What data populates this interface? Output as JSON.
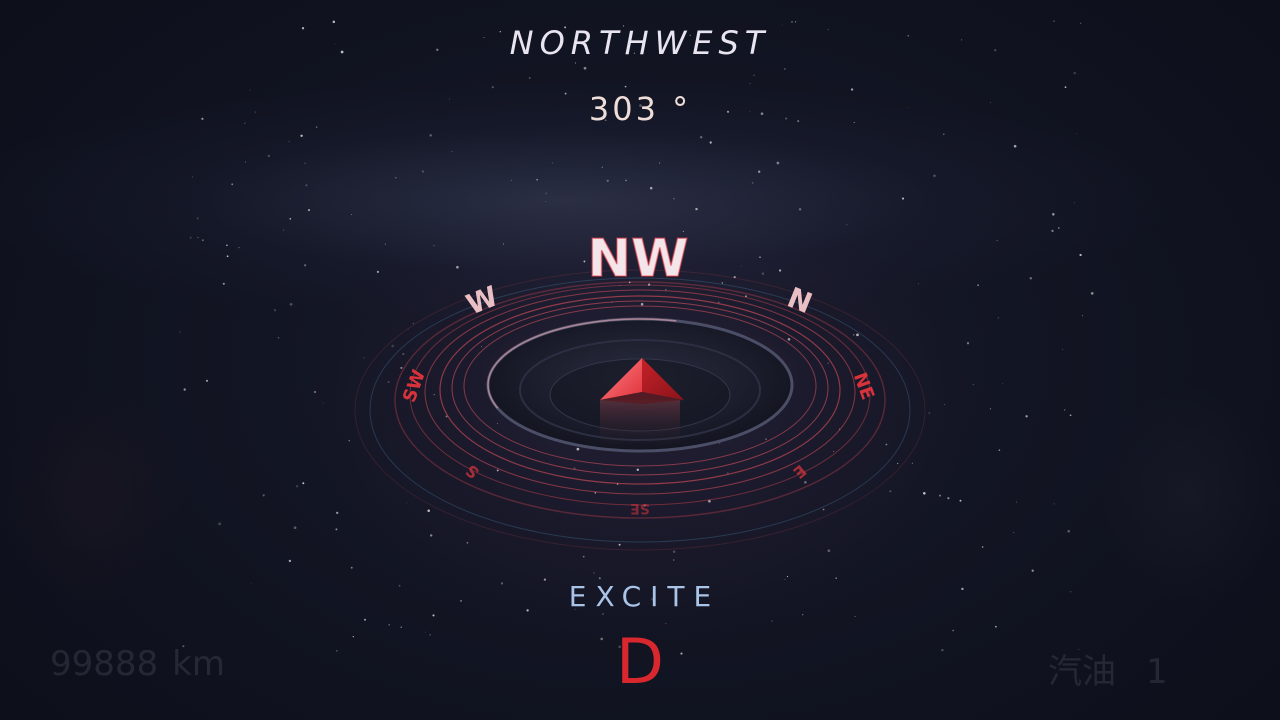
{
  "heading": {
    "direction_name": "NORTHWEST",
    "degrees": "303 °"
  },
  "compass": {
    "heading_value": 303,
    "labels": {
      "front": "NW",
      "left_upper": "W",
      "right_upper": "N",
      "left_side": "SW",
      "right_side": "NE",
      "left_lower": "S",
      "right_lower": "E",
      "back": "SE"
    },
    "arrow_icon": "navigation-arrow-icon"
  },
  "drive": {
    "mode": "EXCITE",
    "gear": "D"
  },
  "odometer": {
    "value": "99888",
    "unit": "km"
  },
  "fuel": {
    "label": "汽油",
    "value": "1"
  },
  "colors": {
    "accent_red": "#e0333a",
    "mode_blue": "#a9c4e6",
    "background": "#10121f"
  }
}
